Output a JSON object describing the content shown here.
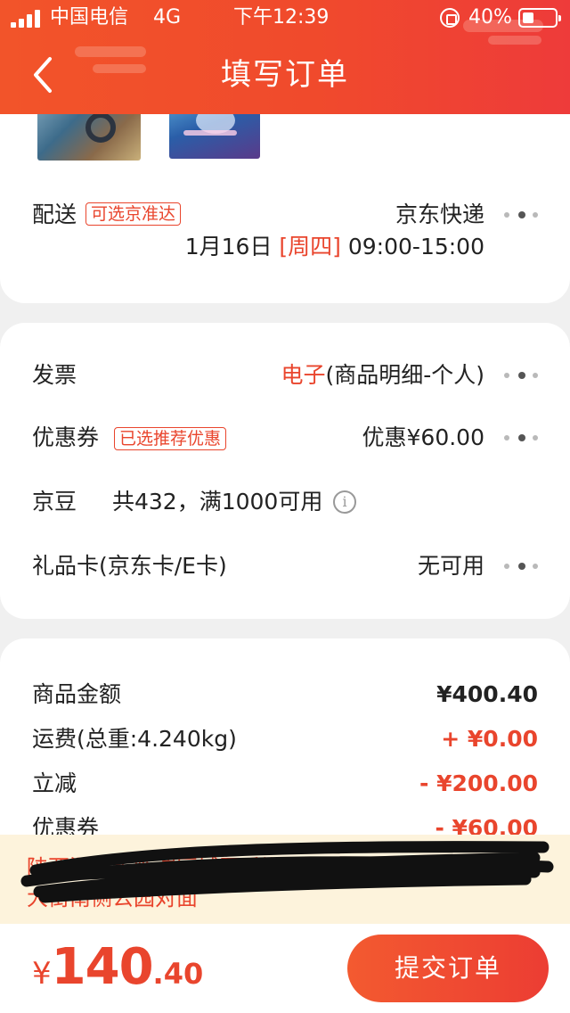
{
  "status": {
    "carrier": "中国电信",
    "network": "4G",
    "time": "下午12:39",
    "battery": "40%"
  },
  "header": {
    "title": "填写订单"
  },
  "delivery": {
    "label": "配送",
    "tag": "可选京准达",
    "method": "京东快递",
    "date": "1月16日",
    "weekday": "[周四]",
    "time_window": "09:00-15:00"
  },
  "invoice": {
    "label": "发票",
    "type": "电子",
    "detail": "(商品明细-个人)"
  },
  "coupon": {
    "label": "优惠券",
    "tag": "已选推荐优惠",
    "value": "优惠¥60.00"
  },
  "jingdou": {
    "label": "京豆",
    "info": "共432，满1000可用"
  },
  "giftcard": {
    "label": "礼品卡(京东卡/E卡)",
    "value": "无可用"
  },
  "summary": {
    "goods_label": "商品金额",
    "goods_value": "¥400.40",
    "shipping_label": "运费(总重:4.240kg)",
    "shipping_value": "+ ¥0.00",
    "discount_label": "立减",
    "discount_value": "- ¥200.00",
    "coupon_label": "优惠券",
    "coupon_value": "- ¥60.00"
  },
  "address": {
    "line1": "陕西渭南市临渭区城区秀湖公园东门北侧新城",
    "line2": "大街南侧公园对面"
  },
  "bottom": {
    "currency": "¥",
    "total_int": "140",
    "total_dec": ".40",
    "submit_label": "提交订单"
  },
  "colors": {
    "accent": "#e9452d",
    "header": "#f04a2c",
    "address_bg": "#fdf3dc"
  },
  "icons": [
    "signal-icon",
    "alarm-lock-icon",
    "battery-icon",
    "back-arrow-icon",
    "more-dots-icon",
    "info-icon"
  ]
}
